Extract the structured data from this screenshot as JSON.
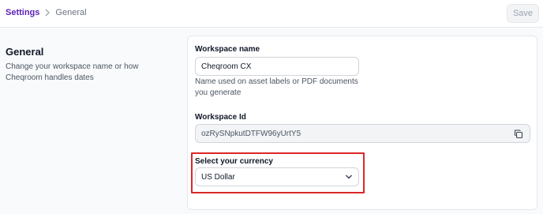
{
  "breadcrumb": {
    "root": "Settings",
    "current": "General"
  },
  "toolbar": {
    "save_label": "Save"
  },
  "section": {
    "title": "General",
    "description": "Change your workspace name or how Cheqroom handles dates"
  },
  "workspace_name": {
    "label": "Workspace name",
    "value": "Cheqroom CX",
    "hint": "Name used on asset labels or PDF documents you generate"
  },
  "workspace_id": {
    "label": "Workspace Id",
    "value": "ozRySNpkutDTFW96yUrtY5"
  },
  "currency": {
    "label": "Select your currency",
    "selected": "US Dollar"
  },
  "icons": {
    "breadcrumb_separator": "chevron-right-icon",
    "copy": "copy-icon",
    "dropdown": "chevron-down-icon"
  },
  "colors": {
    "accent": "#5b21b6",
    "highlight": "#dc2626"
  }
}
